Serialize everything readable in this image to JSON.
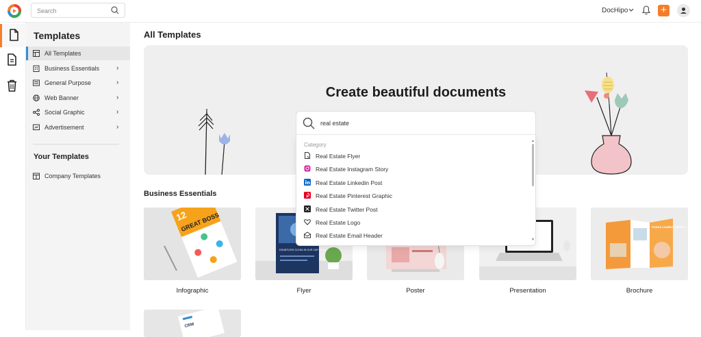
{
  "header": {
    "search_placeholder": "Search",
    "account_name": "DocHipo",
    "add_label": "+",
    "accent": "#f47d2b"
  },
  "rail": {
    "items": [
      {
        "icon": "document-icon",
        "active": true
      },
      {
        "icon": "file-text-icon",
        "active": false
      },
      {
        "icon": "trash-icon",
        "active": false
      }
    ]
  },
  "sidebar": {
    "title": "Templates",
    "items": [
      {
        "label": "All Templates",
        "icon": "grid-icon",
        "active": true
      },
      {
        "label": "Business Essentials",
        "icon": "building-icon"
      },
      {
        "label": "General Purpose",
        "icon": "list-icon"
      },
      {
        "label": "Web Banner",
        "icon": "globe-icon"
      },
      {
        "label": "Social Graphic",
        "icon": "share-icon"
      },
      {
        "label": "Advertisement",
        "icon": "megaphone-icon"
      }
    ],
    "your_templates_title": "Your Templates",
    "your_items": [
      {
        "label": "Company Templates",
        "icon": "company-icon"
      }
    ]
  },
  "main": {
    "title": "All Templates",
    "hero_title": "Create beautiful documents",
    "search_value": "real estate",
    "dropdown": {
      "category_label": "Category",
      "items": [
        {
          "label": "Real Estate Flyer",
          "icon": "flyer-icon"
        },
        {
          "label": "Real Estate Instagram Story",
          "icon": "instagram-icon"
        },
        {
          "label": "Real Estate Linkedin Post",
          "icon": "linkedin-icon"
        },
        {
          "label": "Real Estate Pinterest Graphic",
          "icon": "pinterest-icon"
        },
        {
          "label": "Real Estate Twitter Post",
          "icon": "x-twitter-icon"
        },
        {
          "label": "Real Estate Logo",
          "icon": "heart-icon"
        },
        {
          "label": "Real Estate Email Header",
          "icon": "mail-icon"
        }
      ]
    },
    "section_title": "Business Essentials",
    "cards": [
      {
        "label": "Infographic"
      },
      {
        "label": "Flyer"
      },
      {
        "label": "Poster"
      },
      {
        "label": "Presentation"
      },
      {
        "label": "Brochure"
      }
    ],
    "thumb_text": {
      "infographic_number": "12",
      "infographic_headline": "GREAT BOSS",
      "flyer_headline": "DOUBTLESS CLEAN IN OUR CAR WASH SERVICES",
      "brochure_headline": "Future Leaders School",
      "crm_text": "CRM"
    }
  }
}
